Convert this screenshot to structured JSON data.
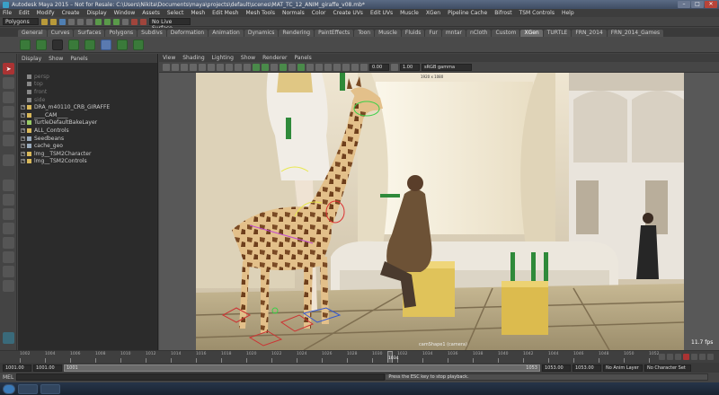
{
  "window": {
    "title": "Autodesk Maya 2015 – Not for Resale: C:\\Users\\Nikita\\Documents\\maya\\projects\\default\\scenes\\MAT_TC_12_ANIM_giraffe_v08.mb*",
    "min_label": "–",
    "max_label": "□",
    "close_label": "✕"
  },
  "menubar": {
    "items": [
      "File",
      "Edit",
      "Modify",
      "Create",
      "Display",
      "Window",
      "Assets",
      "Select",
      "Mesh",
      "Edit Mesh",
      "Mesh Tools",
      "Normals",
      "Color",
      "Create UVs",
      "Edit UVs",
      "Muscle",
      "XGen",
      "Pipeline Cache",
      "Bifrost",
      "TSM Controls",
      "Help"
    ]
  },
  "statusline": {
    "mode": "Polygons",
    "live_surface": "No Live Surface"
  },
  "shelf": {
    "tabs": [
      "General",
      "Curves",
      "Surfaces",
      "Polygons",
      "Subdivs",
      "Deformation",
      "Animation",
      "Dynamics",
      "Rendering",
      "PaintEffects",
      "Toon",
      "Muscle",
      "Fluids",
      "Fur",
      "mntar",
      "nCloth",
      "Custom",
      "XGen",
      "TURTLE",
      "FRN_2014",
      "FRN_2014_Games"
    ],
    "active_tab": "XGen"
  },
  "outliner": {
    "menu": [
      "Display",
      "Show",
      "Panels"
    ],
    "items": [
      {
        "label": "persp",
        "dim": true,
        "icon": "camera-icon"
      },
      {
        "label": "top",
        "dim": true,
        "icon": "camera-icon"
      },
      {
        "label": "front",
        "dim": true,
        "icon": "camera-icon"
      },
      {
        "label": "side",
        "dim": true,
        "icon": "camera-icon"
      },
      {
        "label": "DRA_m40110_CRB_GIRAFFE",
        "dim": false,
        "icon": "group-icon"
      },
      {
        "label": "____CAM____",
        "dim": false,
        "icon": "group-icon"
      },
      {
        "label": "TurtleDefaultBakeLayer",
        "dim": false,
        "icon": "set-icon"
      },
      {
        "label": "ALL_Controls",
        "dim": false,
        "icon": "group-icon"
      },
      {
        "label": "Seedbeans",
        "dim": false,
        "icon": "mesh-icon"
      },
      {
        "label": "cache_geo",
        "dim": false,
        "icon": "mesh-icon"
      },
      {
        "label": "lmg__TSM2Character",
        "dim": false,
        "icon": "group-icon"
      },
      {
        "label": "lmg__TSM2Controls",
        "dim": false,
        "icon": "group-icon"
      }
    ]
  },
  "viewport": {
    "menu": [
      "View",
      "Shading",
      "Lighting",
      "Show",
      "Renderer",
      "Panels"
    ],
    "near_value": "0.00",
    "far_value": "1.00",
    "color_space": "sRGB gamma",
    "camera_label": "camShape1 (camera)",
    "resolution_label": "1920 x 1080",
    "fps": "11.7 fps"
  },
  "timeslider": {
    "ticks": [
      "1002",
      "1004",
      "1006",
      "1008",
      "1010",
      "1012",
      "1014",
      "1016",
      "1018",
      "1020",
      "1022",
      "1024",
      "1026",
      "1028",
      "1030",
      "1032",
      "1034",
      "1036",
      "1038",
      "1040",
      "1042",
      "1044",
      "1046",
      "1048",
      "1050",
      "1052"
    ],
    "current_frame": "1034"
  },
  "range": {
    "start": "1001.00",
    "playback_start": "1001.00",
    "bar_label": "1001",
    "bar_end_label": "1053",
    "playback_end": "1053.00",
    "end": "1053.00",
    "anim_layer": "No Anim Layer",
    "character_set": "No Character Set"
  },
  "commandline": {
    "label": "MEL",
    "result": "Press the ESC key to stop playback."
  }
}
